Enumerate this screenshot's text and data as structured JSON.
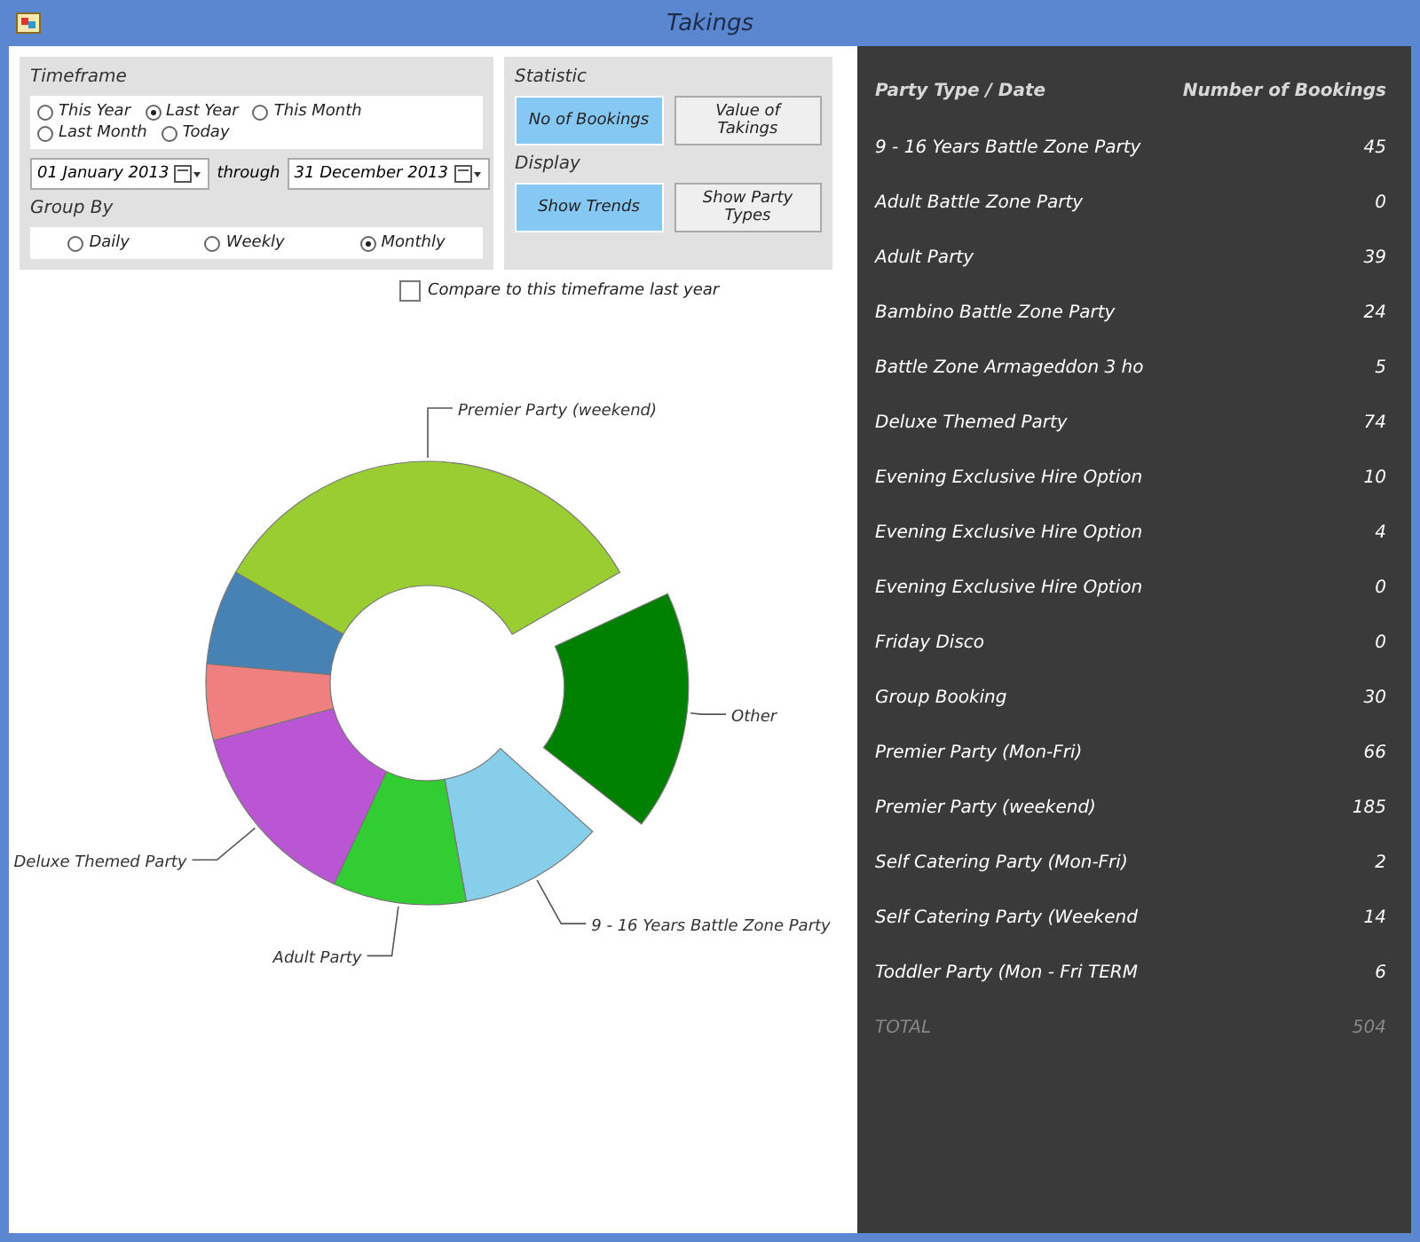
{
  "window": {
    "title": "Takings"
  },
  "timeframe": {
    "label": "Timeframe",
    "options": [
      {
        "label": "This Year",
        "selected": false
      },
      {
        "label": "Last Year",
        "selected": true
      },
      {
        "label": "This Month",
        "selected": false
      },
      {
        "label": "Last Month",
        "selected": false
      },
      {
        "label": "Today",
        "selected": false
      }
    ],
    "from": "01  January  2013",
    "through_label": "through",
    "to": "31  December  2013"
  },
  "group_by": {
    "label": "Group By",
    "options": [
      {
        "label": "Daily",
        "selected": false
      },
      {
        "label": "Weekly",
        "selected": false
      },
      {
        "label": "Monthly",
        "selected": true
      }
    ]
  },
  "statistic": {
    "label": "Statistic",
    "options": [
      {
        "label": "No of Bookings",
        "selected": true
      },
      {
        "label": "Value of Takings",
        "selected": false
      }
    ]
  },
  "display": {
    "label": "Display",
    "options": [
      {
        "label": "Show Trends",
        "selected": true
      },
      {
        "label": "Show Party Types",
        "selected": false
      }
    ]
  },
  "compare": {
    "label": "Compare to this timeframe last year",
    "checked": false
  },
  "chart": {
    "slices": [
      {
        "label": "Premier Party (weekend)",
        "color": "#9acd32"
      },
      {
        "label": "Other",
        "color": "#008000"
      },
      {
        "label": "9 - 16 Years Battle Zone Party",
        "color": "#87ceeb"
      },
      {
        "label": "Adult Party",
        "color": "#32cd32"
      },
      {
        "label": "Deluxe Themed Party",
        "color": "#ba55d3"
      },
      {
        "color": "#f08080"
      },
      {
        "color": "#4682b4"
      }
    ]
  },
  "table": {
    "columns": [
      "Party Type / Date",
      "Number of Bookings"
    ],
    "rows": [
      {
        "name": "9 - 16 Years Battle Zone Party",
        "value": "45"
      },
      {
        "name": "Adult Battle Zone Party",
        "value": "0"
      },
      {
        "name": "Adult Party",
        "value": "39"
      },
      {
        "name": "Bambino Battle Zone Party",
        "value": "24"
      },
      {
        "name": "Battle Zone Armageddon 3 ho",
        "value": "5"
      },
      {
        "name": "Deluxe Themed Party",
        "value": "74"
      },
      {
        "name": "Evening Exclusive Hire Option",
        "value": "10"
      },
      {
        "name": "Evening Exclusive Hire Option",
        "value": "4"
      },
      {
        "name": "Evening Exclusive Hire Option",
        "value": "0"
      },
      {
        "name": "Friday Disco",
        "value": "0"
      },
      {
        "name": "Group Booking",
        "value": "30"
      },
      {
        "name": "Premier Party (Mon-Fri)",
        "value": "66"
      },
      {
        "name": "Premier Party (weekend)",
        "value": "185"
      },
      {
        "name": "Self Catering Party (Mon-Fri)",
        "value": "2"
      },
      {
        "name": "Self Catering Party (Weekend",
        "value": "14"
      },
      {
        "name": "Toddler Party (Mon - Fri TERM",
        "value": "6"
      }
    ],
    "total": {
      "name": "TOTAL",
      "value": "504"
    }
  }
}
